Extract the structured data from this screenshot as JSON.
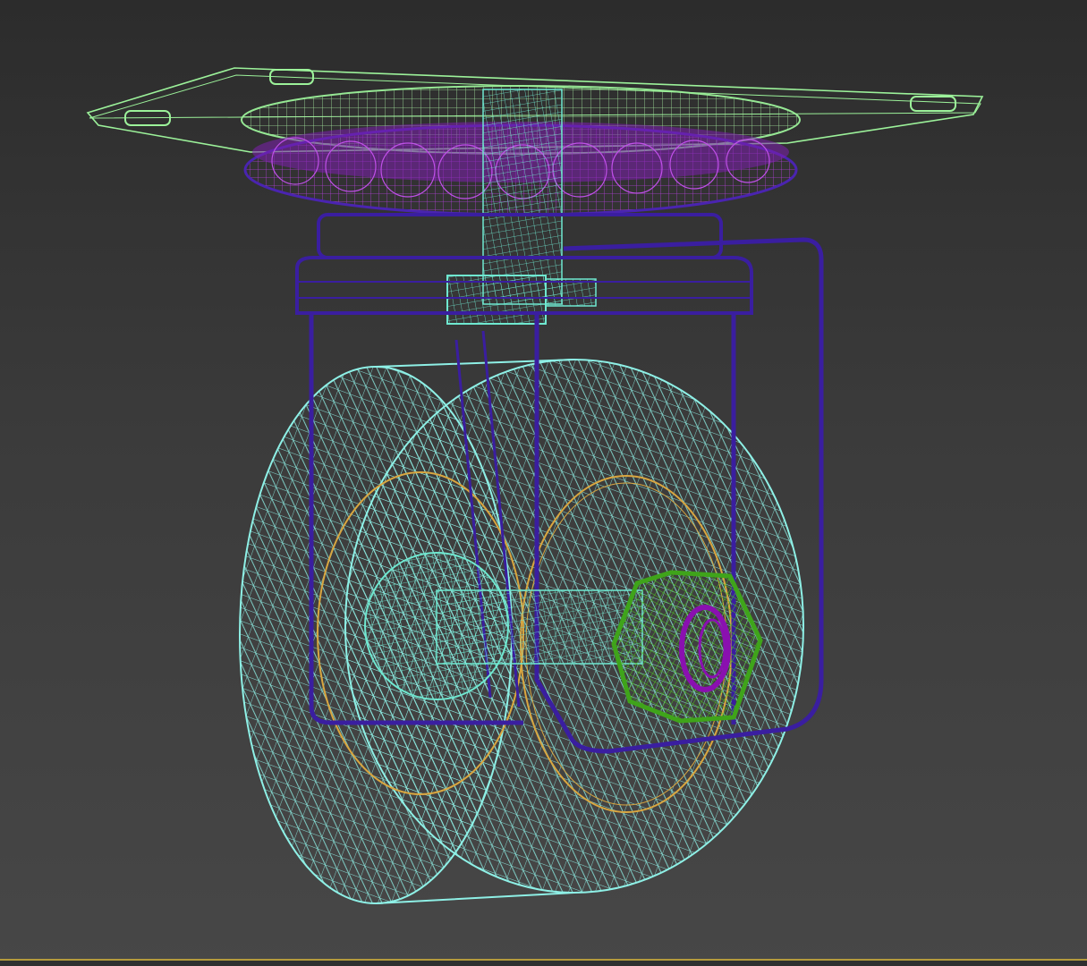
{
  "viewport": {
    "background_top": "#2c2c2c",
    "background_bottom": "#474747",
    "active_border_color": "#b49a3c",
    "render_mode": "wireframe"
  },
  "model": {
    "parts": [
      {
        "name": "mounting-plate",
        "color": "#9cf29a"
      },
      {
        "name": "ball-bearing-race",
        "color": "#8a2bb8"
      },
      {
        "name": "swivel-housing",
        "color": "#3a1ea0"
      },
      {
        "name": "kingpin",
        "color": "#6fe8d0"
      },
      {
        "name": "fork",
        "color": "#3a1ea0"
      },
      {
        "name": "wheel-tire",
        "color": "#8ef0e6"
      },
      {
        "name": "wheel-hub",
        "color": "#d9a640"
      },
      {
        "name": "axle",
        "color": "#6fe8d0"
      },
      {
        "name": "axle-nut",
        "color": "#3fa41a"
      },
      {
        "name": "nut-washer",
        "color": "#8a10b0"
      }
    ]
  }
}
